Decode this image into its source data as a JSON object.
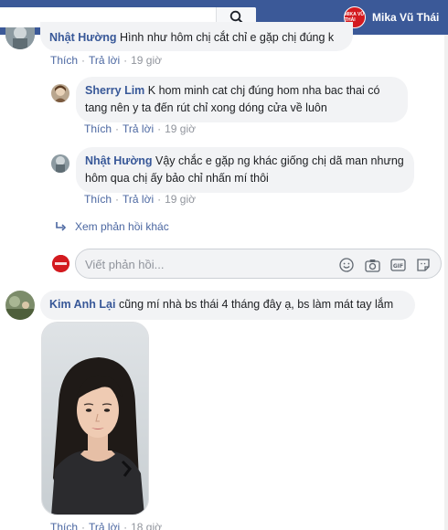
{
  "header": {
    "search_placeholder": "",
    "profile_name": "Mika Vũ Thái",
    "profile_logo_text": "MIKA VŨ THÁI"
  },
  "comments": [
    {
      "author": "Nhật Hường",
      "text": "Hình như hôm chị cắt chỉ e gặp chị đúng k",
      "like": "Thích",
      "reply": "Trả lời",
      "time": "19 giờ"
    },
    {
      "author": "Sherry Lim",
      "text": "K hom minh cat chj đúng hom nha bac thai có tang nên y ta đến rút chỉ xong dóng cửa về luôn",
      "like": "Thích",
      "reply": "Trả lời",
      "time": "19 giờ"
    },
    {
      "author": "Nhật Hường",
      "text": "Vậy chắc e gặp ng khác giống chị dã man nhưng hôm qua chị ấy bảo chỉ nhấn mí thôi",
      "like": "Thích",
      "reply": "Trả lời",
      "time": "19 giờ"
    }
  ],
  "more_replies": "Xem phản hồi khác",
  "reply_box": {
    "placeholder": "Viết phản hồi...",
    "icons": [
      "emoji-icon",
      "camera-icon",
      "gif-icon",
      "sticker-icon"
    ]
  },
  "post_comment": {
    "author": "Kim Anh Lại",
    "text": "cũng mí nhà bs thái 4 tháng đây ạ, bs làm mát tay lắm",
    "like": "Thích",
    "reply": "Trả lời",
    "time": "18 giờ"
  },
  "colors": {
    "topbar": "#3b5998",
    "link": "#385898",
    "bubble": "#f2f3f5",
    "meta": "#90949c"
  }
}
